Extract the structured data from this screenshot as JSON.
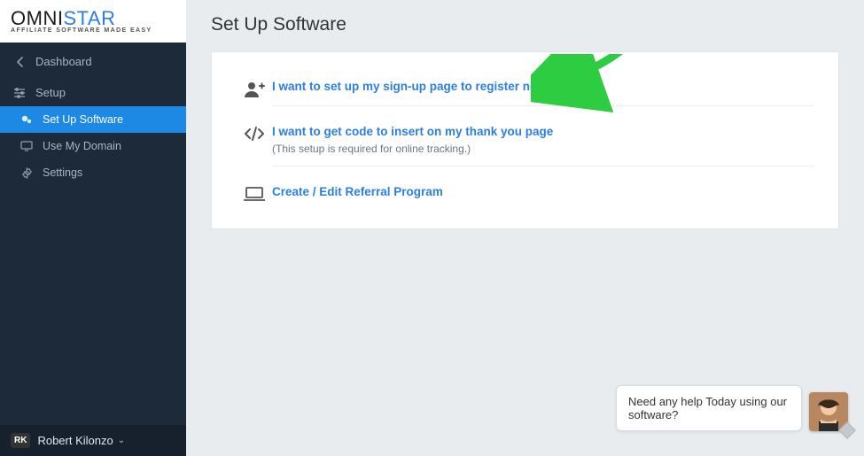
{
  "brand": {
    "main_a": "OMNI",
    "main_b": "STAR",
    "tagline": "AFFILIATE SOFTWARE MADE EASY"
  },
  "nav": {
    "back_label": "Dashboard",
    "setup_label": "Setup",
    "items": [
      {
        "label": "Set Up Software"
      },
      {
        "label": "Use My Domain"
      },
      {
        "label": "Settings"
      }
    ]
  },
  "user": {
    "initials": "RK",
    "name": "Robert Kilonzo"
  },
  "page": {
    "title": "Set Up Software"
  },
  "options": [
    {
      "label": "I want to set up my sign-up page to register new users",
      "note": ""
    },
    {
      "label": "I want to get code to insert on my thank you page",
      "note": "(This setup is required for online tracking.)"
    },
    {
      "label": "Create / Edit Referral Program",
      "note": ""
    }
  ],
  "chat": {
    "message": "Need any help Today using our software?"
  }
}
